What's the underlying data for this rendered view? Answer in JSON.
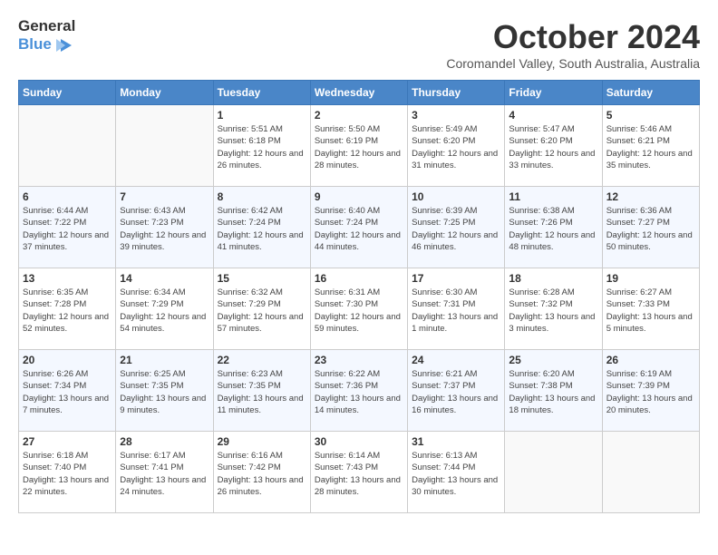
{
  "header": {
    "logo_general": "General",
    "logo_blue": "Blue",
    "month_title": "October 2024",
    "subtitle": "Coromandel Valley, South Australia, Australia"
  },
  "weekdays": [
    "Sunday",
    "Monday",
    "Tuesday",
    "Wednesday",
    "Thursday",
    "Friday",
    "Saturday"
  ],
  "weeks": [
    [
      {
        "day": "",
        "empty": true
      },
      {
        "day": "",
        "empty": true
      },
      {
        "day": "1",
        "sunrise": "Sunrise: 5:51 AM",
        "sunset": "Sunset: 6:18 PM",
        "daylight": "Daylight: 12 hours and 26 minutes."
      },
      {
        "day": "2",
        "sunrise": "Sunrise: 5:50 AM",
        "sunset": "Sunset: 6:19 PM",
        "daylight": "Daylight: 12 hours and 28 minutes."
      },
      {
        "day": "3",
        "sunrise": "Sunrise: 5:49 AM",
        "sunset": "Sunset: 6:20 PM",
        "daylight": "Daylight: 12 hours and 31 minutes."
      },
      {
        "day": "4",
        "sunrise": "Sunrise: 5:47 AM",
        "sunset": "Sunset: 6:20 PM",
        "daylight": "Daylight: 12 hours and 33 minutes."
      },
      {
        "day": "5",
        "sunrise": "Sunrise: 5:46 AM",
        "sunset": "Sunset: 6:21 PM",
        "daylight": "Daylight: 12 hours and 35 minutes."
      }
    ],
    [
      {
        "day": "6",
        "sunrise": "Sunrise: 6:44 AM",
        "sunset": "Sunset: 7:22 PM",
        "daylight": "Daylight: 12 hours and 37 minutes."
      },
      {
        "day": "7",
        "sunrise": "Sunrise: 6:43 AM",
        "sunset": "Sunset: 7:23 PM",
        "daylight": "Daylight: 12 hours and 39 minutes."
      },
      {
        "day": "8",
        "sunrise": "Sunrise: 6:42 AM",
        "sunset": "Sunset: 7:24 PM",
        "daylight": "Daylight: 12 hours and 41 minutes."
      },
      {
        "day": "9",
        "sunrise": "Sunrise: 6:40 AM",
        "sunset": "Sunset: 7:24 PM",
        "daylight": "Daylight: 12 hours and 44 minutes."
      },
      {
        "day": "10",
        "sunrise": "Sunrise: 6:39 AM",
        "sunset": "Sunset: 7:25 PM",
        "daylight": "Daylight: 12 hours and 46 minutes."
      },
      {
        "day": "11",
        "sunrise": "Sunrise: 6:38 AM",
        "sunset": "Sunset: 7:26 PM",
        "daylight": "Daylight: 12 hours and 48 minutes."
      },
      {
        "day": "12",
        "sunrise": "Sunrise: 6:36 AM",
        "sunset": "Sunset: 7:27 PM",
        "daylight": "Daylight: 12 hours and 50 minutes."
      }
    ],
    [
      {
        "day": "13",
        "sunrise": "Sunrise: 6:35 AM",
        "sunset": "Sunset: 7:28 PM",
        "daylight": "Daylight: 12 hours and 52 minutes."
      },
      {
        "day": "14",
        "sunrise": "Sunrise: 6:34 AM",
        "sunset": "Sunset: 7:29 PM",
        "daylight": "Daylight: 12 hours and 54 minutes."
      },
      {
        "day": "15",
        "sunrise": "Sunrise: 6:32 AM",
        "sunset": "Sunset: 7:29 PM",
        "daylight": "Daylight: 12 hours and 57 minutes."
      },
      {
        "day": "16",
        "sunrise": "Sunrise: 6:31 AM",
        "sunset": "Sunset: 7:30 PM",
        "daylight": "Daylight: 12 hours and 59 minutes."
      },
      {
        "day": "17",
        "sunrise": "Sunrise: 6:30 AM",
        "sunset": "Sunset: 7:31 PM",
        "daylight": "Daylight: 13 hours and 1 minute."
      },
      {
        "day": "18",
        "sunrise": "Sunrise: 6:28 AM",
        "sunset": "Sunset: 7:32 PM",
        "daylight": "Daylight: 13 hours and 3 minutes."
      },
      {
        "day": "19",
        "sunrise": "Sunrise: 6:27 AM",
        "sunset": "Sunset: 7:33 PM",
        "daylight": "Daylight: 13 hours and 5 minutes."
      }
    ],
    [
      {
        "day": "20",
        "sunrise": "Sunrise: 6:26 AM",
        "sunset": "Sunset: 7:34 PM",
        "daylight": "Daylight: 13 hours and 7 minutes."
      },
      {
        "day": "21",
        "sunrise": "Sunrise: 6:25 AM",
        "sunset": "Sunset: 7:35 PM",
        "daylight": "Daylight: 13 hours and 9 minutes."
      },
      {
        "day": "22",
        "sunrise": "Sunrise: 6:23 AM",
        "sunset": "Sunset: 7:35 PM",
        "daylight": "Daylight: 13 hours and 11 minutes."
      },
      {
        "day": "23",
        "sunrise": "Sunrise: 6:22 AM",
        "sunset": "Sunset: 7:36 PM",
        "daylight": "Daylight: 13 hours and 14 minutes."
      },
      {
        "day": "24",
        "sunrise": "Sunrise: 6:21 AM",
        "sunset": "Sunset: 7:37 PM",
        "daylight": "Daylight: 13 hours and 16 minutes."
      },
      {
        "day": "25",
        "sunrise": "Sunrise: 6:20 AM",
        "sunset": "Sunset: 7:38 PM",
        "daylight": "Daylight: 13 hours and 18 minutes."
      },
      {
        "day": "26",
        "sunrise": "Sunrise: 6:19 AM",
        "sunset": "Sunset: 7:39 PM",
        "daylight": "Daylight: 13 hours and 20 minutes."
      }
    ],
    [
      {
        "day": "27",
        "sunrise": "Sunrise: 6:18 AM",
        "sunset": "Sunset: 7:40 PM",
        "daylight": "Daylight: 13 hours and 22 minutes."
      },
      {
        "day": "28",
        "sunrise": "Sunrise: 6:17 AM",
        "sunset": "Sunset: 7:41 PM",
        "daylight": "Daylight: 13 hours and 24 minutes."
      },
      {
        "day": "29",
        "sunrise": "Sunrise: 6:16 AM",
        "sunset": "Sunset: 7:42 PM",
        "daylight": "Daylight: 13 hours and 26 minutes."
      },
      {
        "day": "30",
        "sunrise": "Sunrise: 6:14 AM",
        "sunset": "Sunset: 7:43 PM",
        "daylight": "Daylight: 13 hours and 28 minutes."
      },
      {
        "day": "31",
        "sunrise": "Sunrise: 6:13 AM",
        "sunset": "Sunset: 7:44 PM",
        "daylight": "Daylight: 13 hours and 30 minutes."
      },
      {
        "day": "",
        "empty": true
      },
      {
        "day": "",
        "empty": true
      }
    ]
  ]
}
